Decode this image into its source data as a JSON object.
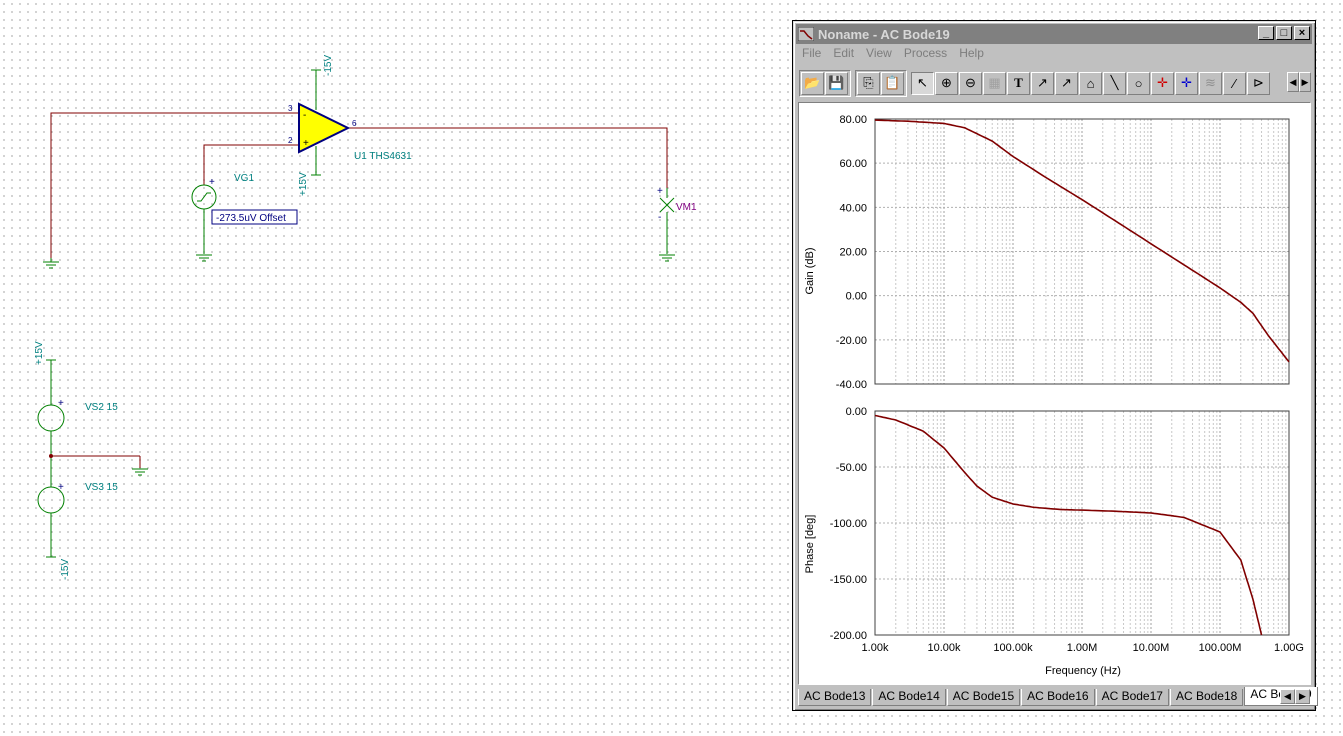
{
  "schematic": {
    "opamp": {
      "name": "U1 THS4631",
      "pin_in_neg": "3",
      "pin_in_pos": "2",
      "pin_out": "6",
      "supply_top": "-15V",
      "supply_bottom": "+15V"
    },
    "source": {
      "name": "VG1",
      "offset_label": "-273.5uV Offset"
    },
    "meter": {
      "name": "VM1"
    },
    "supplies": {
      "vs2": "VS2 15",
      "vs3": "VS3 15",
      "top_label": "+15V",
      "bottom_label": "-15V"
    },
    "plus": "+",
    "minus": "-",
    "colors": {
      "wire": "#800000",
      "component": "#008000",
      "label": "#008080",
      "opamp_fill": "#ffff00"
    }
  },
  "window": {
    "title": "Noname - AC Bode19",
    "controls": {
      "minimize": "_",
      "maximize": "□",
      "close": "×"
    },
    "menu": [
      "File",
      "Edit",
      "View",
      "Process",
      "Help"
    ],
    "toolbar": [
      {
        "icon": "open-folder-icon",
        "glyph": "📂"
      },
      {
        "icon": "save-icon",
        "glyph": "💾"
      },
      {
        "icon": "copy-icon",
        "glyph": "⎘"
      },
      {
        "icon": "paste-icon",
        "glyph": "📋"
      },
      {
        "icon": "select-arrow-icon",
        "glyph": "↖"
      },
      {
        "icon": "zoom-in-icon",
        "glyph": "⊕"
      },
      {
        "icon": "zoom-out-icon",
        "glyph": "⊖"
      },
      {
        "icon": "grid-icon",
        "glyph": "▦"
      },
      {
        "icon": "text-icon",
        "glyph": "T"
      },
      {
        "icon": "annotate-1-icon",
        "glyph": "↗"
      },
      {
        "icon": "annotate-2-icon",
        "glyph": "↗"
      },
      {
        "icon": "annotate-3-icon",
        "glyph": "⌂"
      },
      {
        "icon": "line-icon",
        "glyph": "╲"
      },
      {
        "icon": "circle-icon",
        "glyph": "○"
      },
      {
        "icon": "cursor-a-icon",
        "glyph": "✛"
      },
      {
        "icon": "cursor-b-icon",
        "glyph": "✛"
      },
      {
        "icon": "wave-icon",
        "glyph": "≋"
      },
      {
        "icon": "probe-icon",
        "glyph": "⁄"
      },
      {
        "icon": "marker-icon",
        "glyph": "⊳"
      }
    ],
    "tabs": [
      "AC Bode13",
      "AC Bode14",
      "AC Bode15",
      "AC Bode16",
      "AC Bode17",
      "AC Bode18",
      "AC Bode19"
    ],
    "active_tab": "AC Bode19"
  },
  "chart_data": [
    {
      "type": "line",
      "ylabel": "Gain (dB)",
      "xlabel": "",
      "x_scale": "log",
      "xlim": [
        1000,
        1000000000
      ],
      "ylim": [
        -40,
        80
      ],
      "y_ticks": [
        "80.00",
        "60.00",
        "40.00",
        "20.00",
        "0.00",
        "-20.00",
        "-40.00"
      ],
      "grid": true,
      "color": "#800000",
      "series": [
        {
          "x": [
            1000,
            3000,
            10000,
            20000,
            50000,
            100000,
            300000,
            1000000,
            3000000,
            10000000,
            30000000,
            100000000,
            200000000,
            300000000,
            500000000,
            1000000000
          ],
          "values": [
            79.5,
            79.0,
            78.0,
            76.0,
            70.0,
            63.0,
            53.5,
            43.5,
            34.0,
            23.5,
            14.0,
            3.5,
            -3.0,
            -8.0,
            -18.0,
            -30.0
          ]
        }
      ]
    },
    {
      "type": "line",
      "ylabel": "Phase [deg]",
      "xlabel": "Frequency (Hz)",
      "x_scale": "log",
      "xlim": [
        1000,
        1000000000
      ],
      "ylim": [
        -200,
        0
      ],
      "x_ticks": [
        "1.00k",
        "10.00k",
        "100.00k",
        "1.00M",
        "10.00M",
        "100.00M",
        "1.00G"
      ],
      "y_ticks": [
        "0.00",
        "-50.00",
        "-100.00",
        "-150.00",
        "-200.00"
      ],
      "grid": true,
      "color": "#800000",
      "series": [
        {
          "x": [
            1000,
            2000,
            5000,
            10000,
            20000,
            30000,
            50000,
            100000,
            200000,
            500000,
            1000000,
            3000000,
            10000000,
            30000000,
            100000000,
            200000000,
            300000000,
            400000000
          ],
          "values": [
            -4,
            -8,
            -18,
            -33,
            -55,
            -67,
            -77,
            -83,
            -86,
            -88,
            -88.5,
            -89.5,
            -91,
            -95,
            -108,
            -133,
            -168,
            -200
          ]
        }
      ]
    }
  ]
}
